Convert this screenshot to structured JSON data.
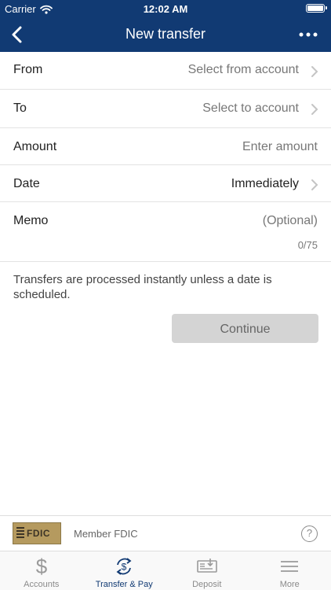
{
  "status_bar": {
    "carrier": "Carrier",
    "time": "12:02 AM"
  },
  "nav": {
    "title": "New transfer",
    "back_icon": "chevron-left-icon",
    "more_icon": "ellipsis-icon"
  },
  "form": {
    "from": {
      "label": "From",
      "value": "Select from account"
    },
    "to": {
      "label": "To",
      "value": "Select to account"
    },
    "amount": {
      "label": "Amount",
      "placeholder": "Enter amount"
    },
    "date": {
      "label": "Date",
      "value": "Immediately"
    },
    "memo": {
      "label": "Memo",
      "placeholder": "(Optional)",
      "counter": "0/75"
    }
  },
  "info_text": "Transfers are processed instantly unless a date is scheduled.",
  "continue_label": "Continue",
  "footer": {
    "logo_text": "FDIC",
    "member_text": "Member FDIC",
    "help_label": "?"
  },
  "tabs": [
    {
      "label": "Accounts",
      "icon": "dollar-icon"
    },
    {
      "label": "Transfer & Pay",
      "icon": "transfer-pay-icon"
    },
    {
      "label": "Deposit",
      "icon": "check-deposit-icon"
    },
    {
      "label": "More",
      "icon": "menu-icon"
    }
  ],
  "colors": {
    "header": "#113a73",
    "accent": "#113a73",
    "button_disabled": "#d4d4d4"
  }
}
